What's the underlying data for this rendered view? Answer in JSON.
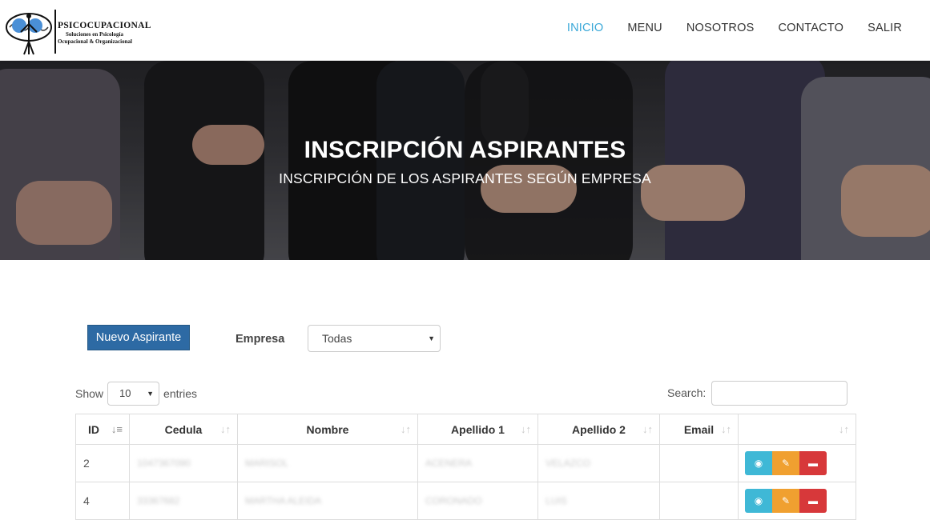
{
  "nav": {
    "brand": "PSICOCUPACIONAL",
    "tagline_1": "Soluciones en Psicología",
    "tagline_2": "Ocupacional & Organizacional",
    "links": [
      "INICIO",
      "MENU",
      "NOSOTROS",
      "CONTACTO",
      "SALIR"
    ],
    "active_color": "#3aa8d8"
  },
  "hero": {
    "title": "INSCRIPCIÓN ASPIRANTES",
    "subtitle": "INSCRIPCIÓN DE LOS ASPIRANTES SEGÚN EMPRESA"
  },
  "controls": {
    "new_button": "Nuevo Aspirante",
    "empresa_label": "Empresa",
    "empresa_value": "Todas",
    "show_label": "Show",
    "entries_value": "10",
    "entries_label": "entries",
    "search_label": "Search:"
  },
  "table": {
    "headers": [
      "ID",
      "Cedula",
      "Nombre",
      "Apellido 1",
      "Apellido 2",
      "Email",
      ""
    ],
    "rows": [
      {
        "id": "2",
        "cedula": "1047367090",
        "nombre": "MARISOL",
        "apellido1": "ACENERA",
        "apellido2": "VELAZCO",
        "email": ""
      },
      {
        "id": "4",
        "cedula": "33367682",
        "nombre": "MARTHA ALEIDA",
        "apellido1": "CORONADO",
        "apellido2": "LUIS",
        "email": ""
      }
    ]
  },
  "colors": {
    "primary": "#2d6aa4",
    "view": "#3fb8d6",
    "edit": "#f0a030",
    "delete": "#d7383a"
  }
}
